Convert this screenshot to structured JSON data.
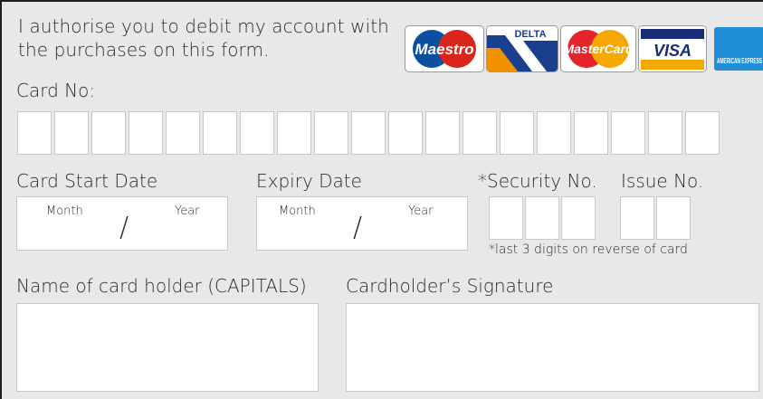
{
  "authorisation_text": "I authorise you to debit my account with the purchases on this form.",
  "card_logos": [
    "Maestro",
    "DELTA",
    "MasterCard",
    "VISA",
    "AMERICAN EXPRESS"
  ],
  "card_number": {
    "label": "Card No:",
    "digit_count": 19
  },
  "start_date": {
    "label": "Card Start Date",
    "month": "Month",
    "year": "Year",
    "separator": "/"
  },
  "expiry_date": {
    "label": "Expiry Date",
    "month": "Month",
    "year": "Year",
    "separator": "/"
  },
  "security": {
    "label": "*Security No.",
    "digit_count": 3,
    "note": "*last 3 digits on reverse of card"
  },
  "issue": {
    "label": "Issue No.",
    "digit_count": 2
  },
  "cardholder_name": {
    "label": "Name of card holder (CAPITALS)"
  },
  "signature": {
    "label": "Cardholder’s Signature"
  },
  "colors": {
    "panel_background": "#e8e8e8",
    "field_background": "#ffffff",
    "field_border": "#c9c9c9",
    "maestro_blue": "#0a4fa0",
    "maestro_red": "#d9251c",
    "delta_blue": "#1a3f8f",
    "delta_orange": "#f39200",
    "mastercard_red": "#e4232a",
    "mastercard_yellow": "#f7a800",
    "visa_blue": "#1a2c78",
    "visa_gold": "#f2a900",
    "amex_blue": "#1f8ed6"
  }
}
